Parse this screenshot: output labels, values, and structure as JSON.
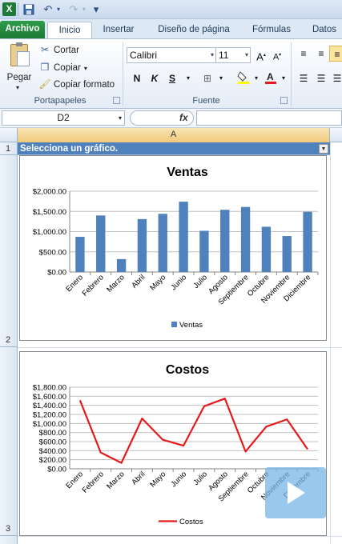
{
  "qat": {
    "undo": "↶",
    "redo": "↷",
    "customize": "▾"
  },
  "tabs": [
    "Archivo",
    "Inicio",
    "Insertar",
    "Diseño de página",
    "Fórmulas",
    "Datos"
  ],
  "ribbon": {
    "paste": "Pegar",
    "cut": "Cortar",
    "copy": "Copiar",
    "format_painter": "Copiar formato",
    "clipboard_group": "Portapapeles",
    "font_name": "Calibri",
    "font_size": "11",
    "font_group": "Fuente",
    "bold": "N",
    "italic": "K",
    "underline": "S"
  },
  "formula_bar": {
    "name_box": "D2",
    "fx": "fx",
    "formula": ""
  },
  "grid": {
    "column_a": "A",
    "rows": [
      "1",
      "2",
      "3"
    ],
    "cell_a1": "Selecciona un gráfico."
  },
  "colors": {
    "ventas_bar": "#4f81bd",
    "costos_line": "#e41a1c",
    "header_fill": "#4f81bd"
  },
  "chart_data": [
    {
      "type": "bar",
      "title": "Ventas",
      "categories": [
        "Enero",
        "Febrero",
        "Marzo",
        "Abril",
        "Mayo",
        "Junio",
        "Julio",
        "Agosto",
        "Septiembre",
        "Octubre",
        "Noviembre",
        "Diciembre"
      ],
      "series": [
        {
          "name": "Ventas",
          "values": [
            870,
            1400,
            320,
            1310,
            1440,
            1740,
            1020,
            1540,
            1610,
            1120,
            890,
            1490
          ]
        }
      ],
      "yticks": [
        "$0.00",
        "$500.00",
        "$1,000.00",
        "$1,500.00",
        "$2,000.00"
      ],
      "ylim": [
        0,
        2000
      ],
      "grid": true,
      "legend": "bottom"
    },
    {
      "type": "line",
      "title": "Costos",
      "categories": [
        "Enero",
        "Febrero",
        "Marzo",
        "Abril",
        "Mayo",
        "Junio",
        "Julio",
        "Agosto",
        "Septiembre",
        "Octubre",
        "Noviembre",
        "Diciembre"
      ],
      "series": [
        {
          "name": "Costos",
          "values": [
            1510,
            360,
            130,
            1110,
            640,
            510,
            1380,
            1550,
            380,
            930,
            1090,
            430
          ]
        }
      ],
      "yticks": [
        "$0.00",
        "$200.00",
        "$400.00",
        "$600.00",
        "$800.00",
        "$1,000.00",
        "$1,200.00",
        "$1,400.00",
        "$1,600.00",
        "$1,800.00"
      ],
      "ylim": [
        0,
        1800
      ],
      "grid": true,
      "legend": "bottom"
    }
  ]
}
